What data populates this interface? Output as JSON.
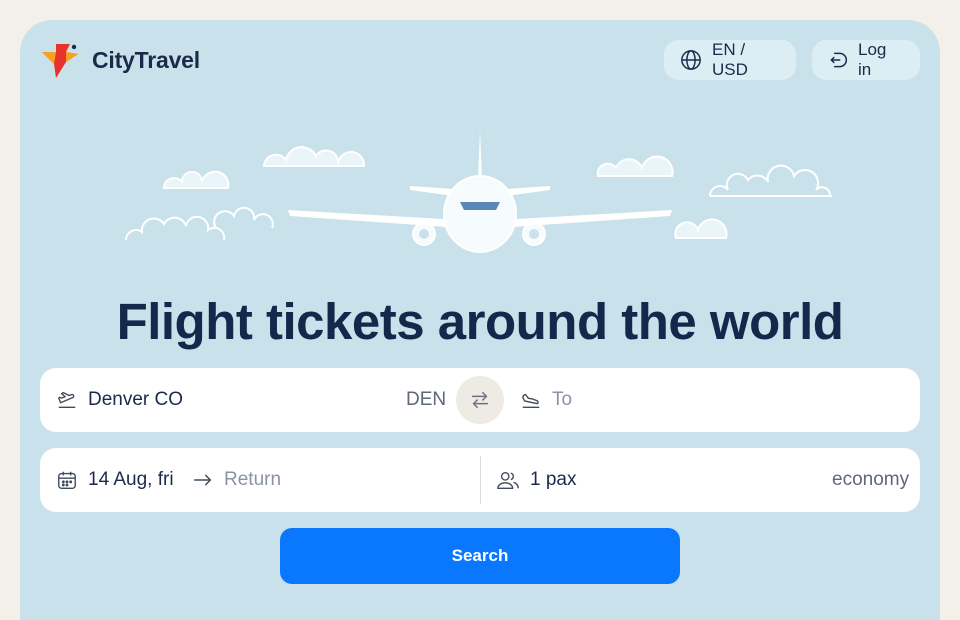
{
  "brand": {
    "name": "CityTravel",
    "colors": {
      "red": "#e8322c",
      "orange": "#f6a21e",
      "navy": "#13294b"
    }
  },
  "header": {
    "language_label": "EN / USD",
    "login_label": "Log in"
  },
  "hero": {
    "headline": "Flight tickets around the world"
  },
  "search": {
    "from_value": "Denver CO",
    "from_code": "DEN",
    "to_placeholder": "To",
    "depart_date": "14 Aug, fri",
    "return_placeholder": "Return",
    "passengers": "1 pax",
    "cabin_class": "economy",
    "search_label": "Search",
    "accent": "#0a77ff"
  },
  "icons": [
    "globe-icon",
    "login-icon",
    "takeoff-icon",
    "landing-icon",
    "swap-icon",
    "calendar-icon",
    "arrow-right-icon",
    "passengers-icon"
  ]
}
